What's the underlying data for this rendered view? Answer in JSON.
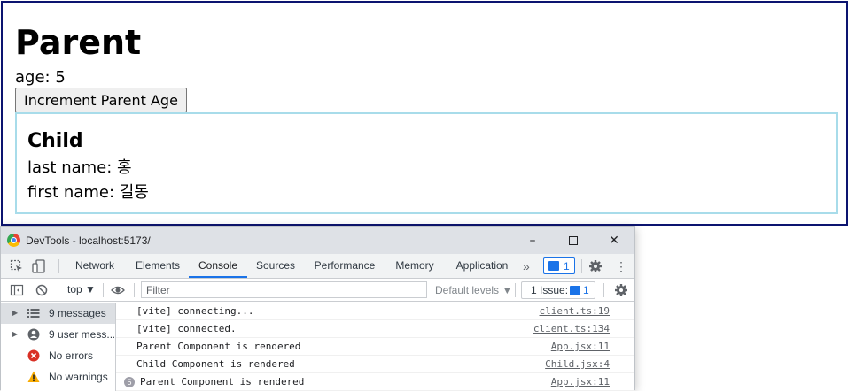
{
  "parent": {
    "title": "Parent",
    "age_label": "age: 5",
    "increment_button": "Increment Parent Age"
  },
  "child": {
    "title": "Child",
    "last_name": "last name: 홍",
    "first_name": "first name: 길동"
  },
  "devtools": {
    "window_title": "DevTools - localhost:5173/",
    "window_controls": {
      "minimize": "–",
      "maximize": "",
      "close": "✕"
    },
    "tabs": [
      {
        "label": "Network"
      },
      {
        "label": "Elements"
      },
      {
        "label": "Console"
      },
      {
        "label": "Sources"
      },
      {
        "label": "Performance"
      },
      {
        "label": "Memory"
      },
      {
        "label": "Application"
      }
    ],
    "active_tab": "Console",
    "more_tabs": "»",
    "message_badge_count": "1",
    "console_bar": {
      "context": "top ▼",
      "filter_placeholder": "Filter",
      "levels": "Default levels ▼",
      "issues_label": "1 Issue:",
      "issues_count": "1"
    },
    "sidebar": [
      {
        "label": "9 messages",
        "icon": "list-icon"
      },
      {
        "label": "9 user mess...",
        "icon": "user-icon"
      },
      {
        "label": "No errors",
        "icon": "error-icon"
      },
      {
        "label": "No warnings",
        "icon": "warning-icon"
      }
    ],
    "log": [
      {
        "message": "[vite] connecting...",
        "source": "client.ts:19"
      },
      {
        "message": "[vite] connected.",
        "source": "client.ts:134"
      },
      {
        "message": "Parent Component is rendered",
        "source": "App.jsx:11"
      },
      {
        "message": "Child Component is rendered",
        "source": "Child.jsx:4"
      },
      {
        "count": "5",
        "message": "Parent Component is rendered",
        "source": "App.jsx:11"
      }
    ],
    "colors": {
      "accent": "#1a73e8",
      "error": "#d93025",
      "warning": "#f9ab00",
      "parent_border": "#0c1470",
      "child_border": "#a8dcea"
    }
  }
}
